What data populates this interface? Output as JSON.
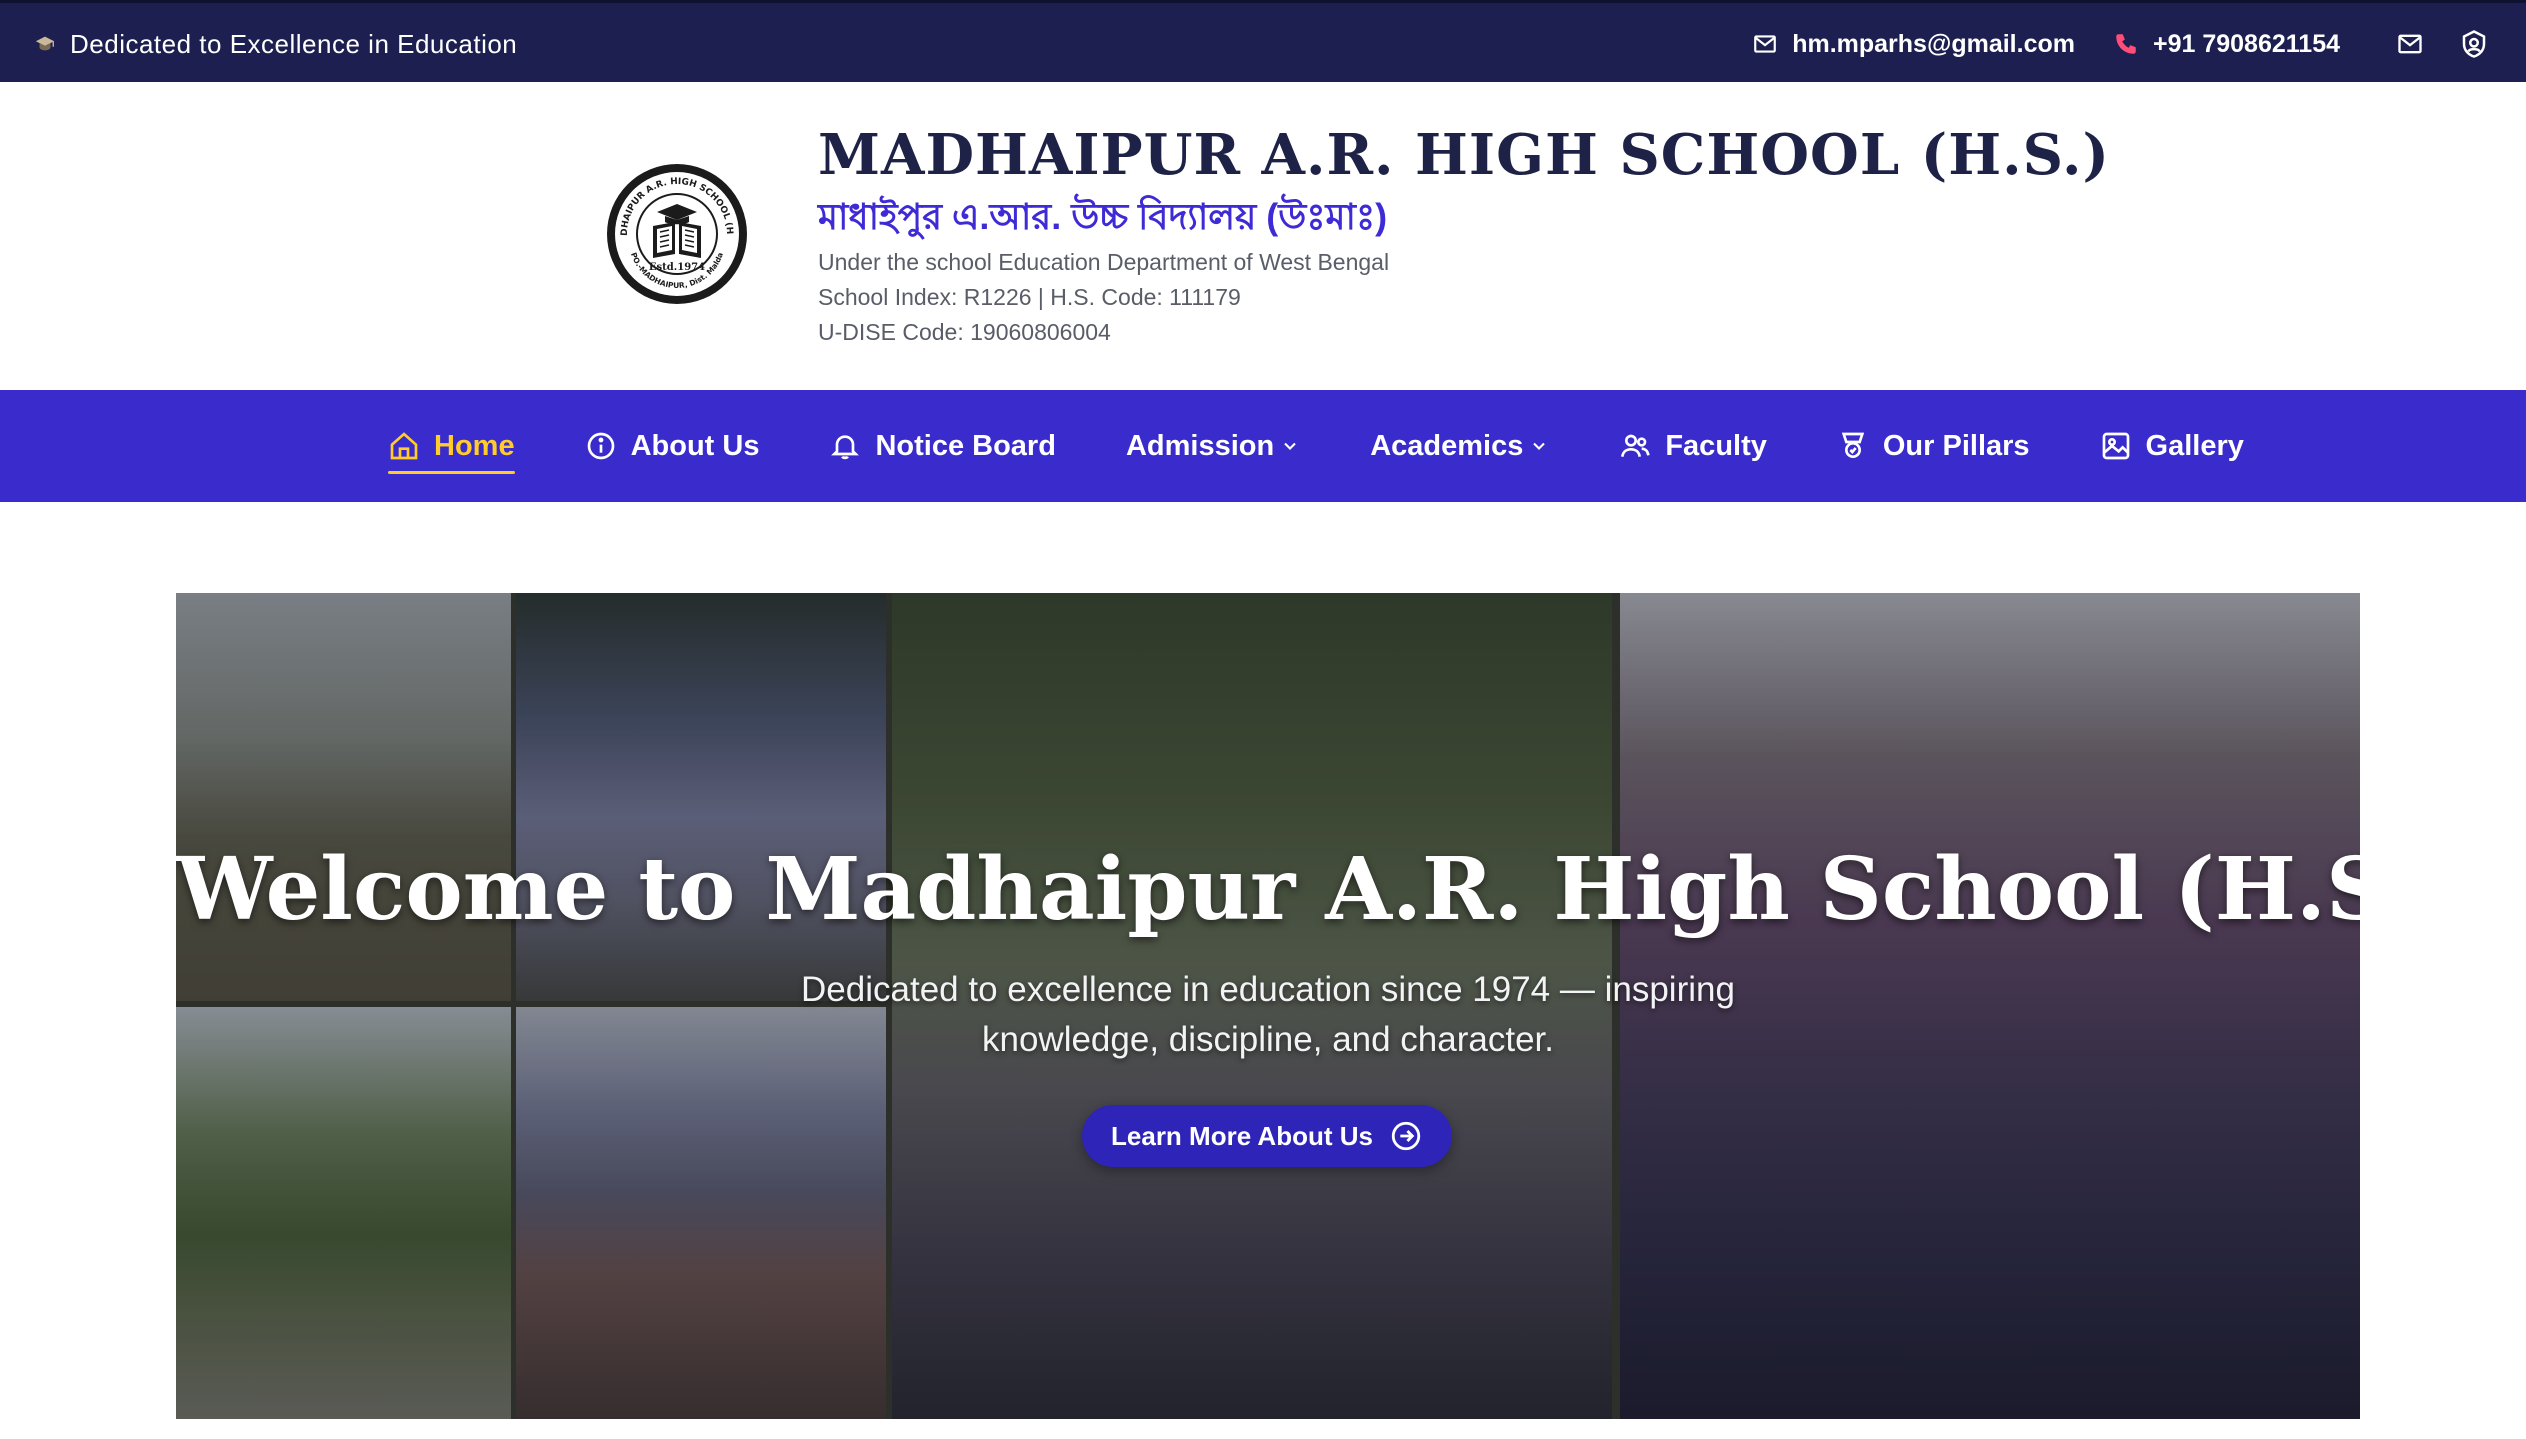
{
  "topbar": {
    "tagline": "Dedicated to Excellence in Education",
    "email": "hm.mparhs@gmail.com",
    "phone": "+91 7908621154",
    "icons": [
      "graduation-cap-icon",
      "mail-icon",
      "phone-icon",
      "mail-icon",
      "shield-icon"
    ]
  },
  "header": {
    "school_name": "MADHAIPUR A.R. HIGH SCHOOL (H.S.)",
    "school_name_bengali": "মাধাইপুর এ.আর. উচ্চ বিদ্যালয় (উঃমাঃ)",
    "meta": [
      "Under the school Education Department of West Bengal",
      "School Index: R1226 | H.S. Code: 111179",
      "U-DISE Code: 19060806004"
    ],
    "logo": {
      "top_text": "MADHAIPUR A.R. HIGH SCHOOL (H.S.)",
      "estd": "Estd.1974",
      "bottom_text": "PO.-MADHAIPUR, Dist. Malda"
    }
  },
  "nav": {
    "items": [
      {
        "label": "Home",
        "icon": "home-icon",
        "active": true
      },
      {
        "label": "About Us",
        "icon": "info-icon"
      },
      {
        "label": "Notice Board",
        "icon": "bell-icon"
      },
      {
        "label": "Admission",
        "icon": "",
        "dropdown": true
      },
      {
        "label": "Academics",
        "icon": "",
        "dropdown": true
      },
      {
        "label": "Faculty",
        "icon": "users-icon"
      },
      {
        "label": "Our Pillars",
        "icon": "award-icon"
      },
      {
        "label": "Gallery",
        "icon": "image-icon"
      }
    ]
  },
  "hero": {
    "title": "Welcome to Madhaipur A.R. High School (H.S.)",
    "subtitle": "Dedicated to excellence in education since 1974 — inspiring knowledge, discipline, and character.",
    "button_label": "Learn More About Us"
  },
  "colors": {
    "topbar_bg": "#1c1f4f",
    "nav_bg": "#3a2bcc",
    "nav_active": "#ffcc29",
    "title_color": "#1d2246",
    "bengali_color": "#3e2bd6",
    "button_bg": "#2e24b8"
  }
}
